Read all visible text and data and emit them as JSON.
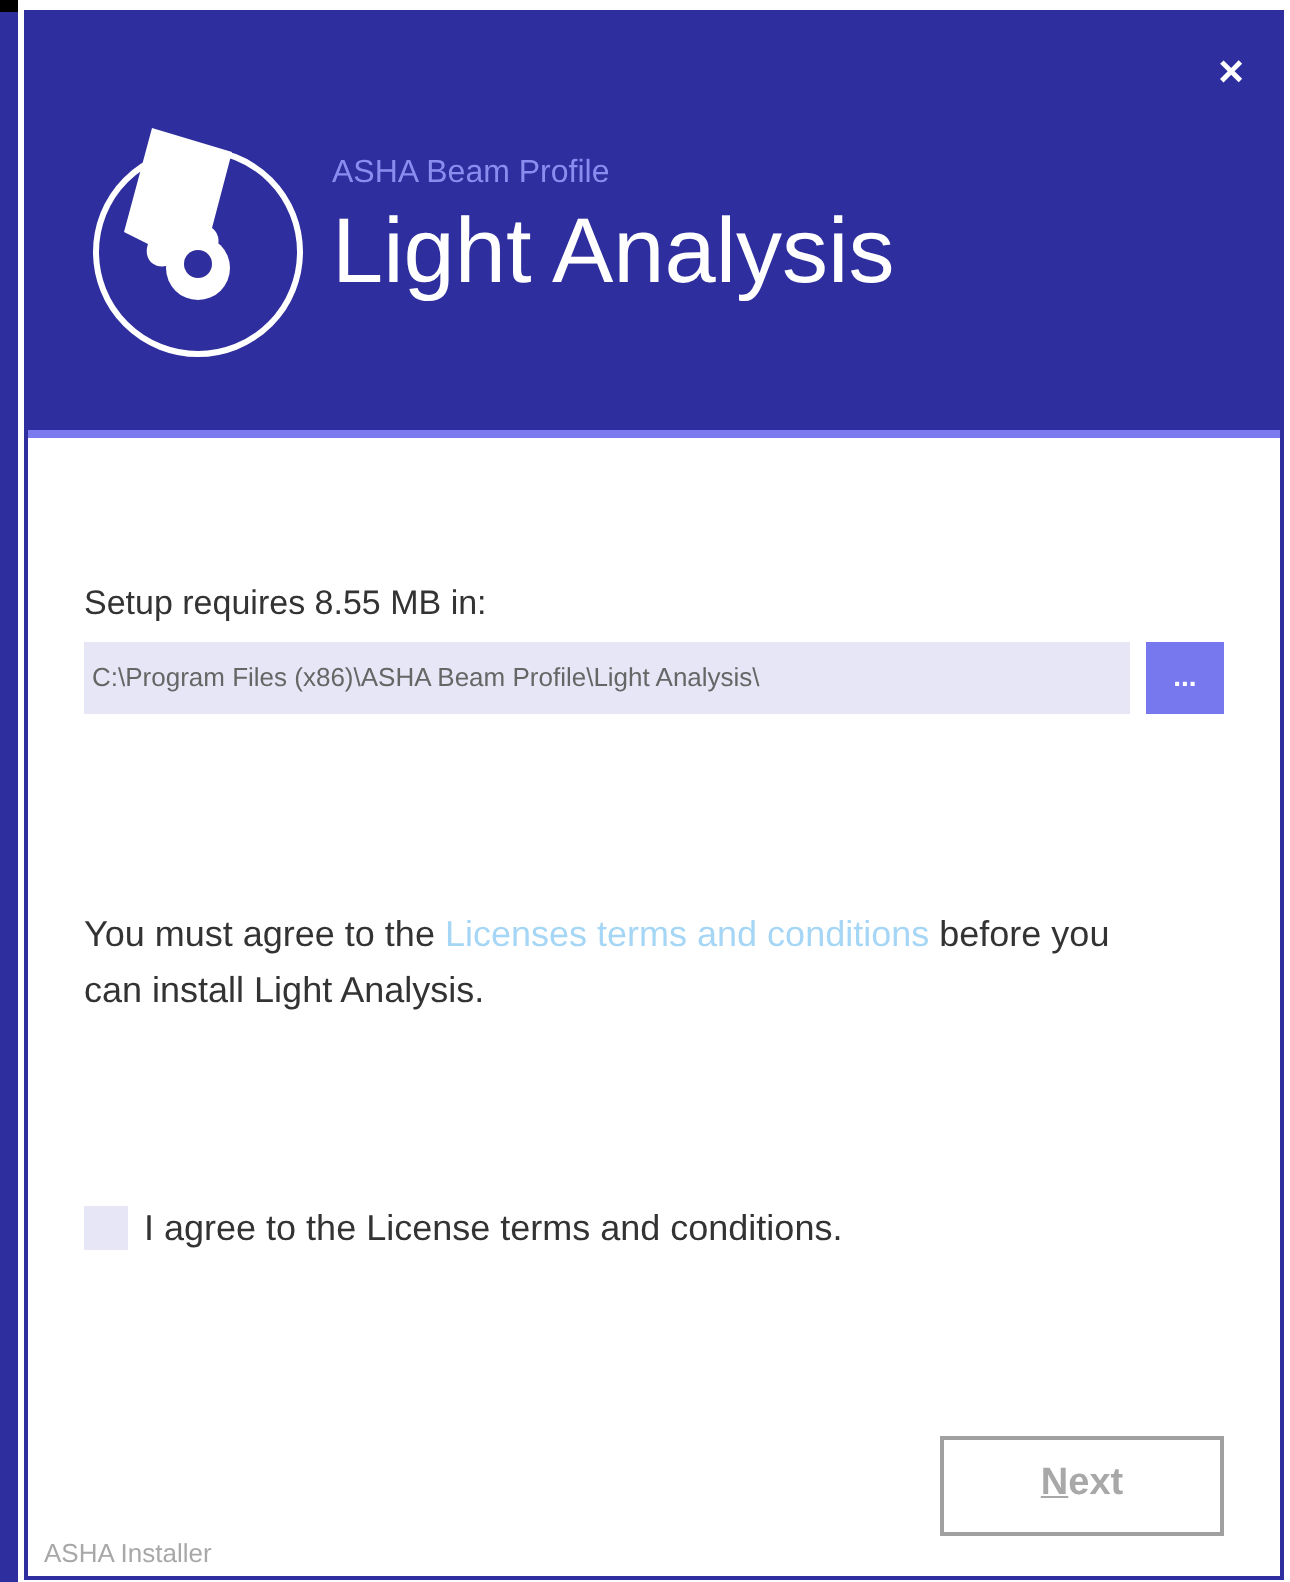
{
  "header": {
    "subtitle": "ASHA Beam Profile",
    "title": "Light Analysis",
    "close": "×"
  },
  "install_location": {
    "label": "Setup requires 8.55 MB in:",
    "path": "C:\\Program Files (x86)\\ASHA Beam Profile\\Light Analysis\\",
    "browse_button": "..."
  },
  "license_notice": {
    "before": "You must agree to the",
    "link": "Licenses terms and conditions",
    "after": "before you can install Light Analysis."
  },
  "agree_checkbox": {
    "label": "I agree to the License terms and conditions.",
    "checked": false
  },
  "next_button": {
    "label": "Next",
    "disabled": true
  },
  "footer": "ASHA Installer"
}
